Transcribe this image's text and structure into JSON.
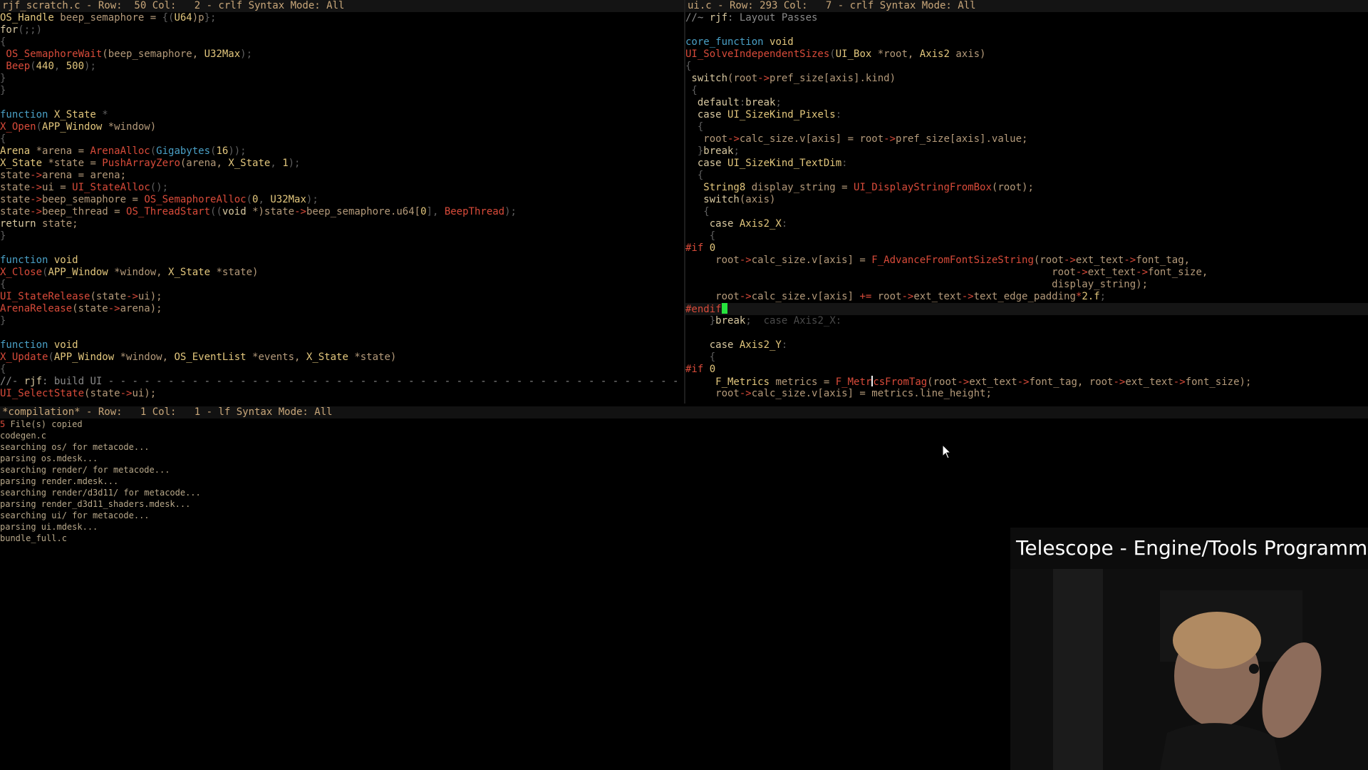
{
  "left_pane": {
    "status": "rjf_scratch.c - Row:  50 Col:   2 - crlf Syntax Mode: All",
    "lines": [
      [
        [
          "OS_Handle ",
          "t"
        ],
        [
          "beep_semaphore = ",
          "v"
        ],
        [
          "{(",
          "m"
        ],
        [
          "U64",
          "t"
        ],
        [
          ")p",
          "v"
        ],
        [
          "};",
          "m"
        ]
      ],
      [
        [
          "for",
          "k"
        ],
        [
          "(;;)",
          "m"
        ]
      ],
      [
        [
          "{",
          "m"
        ]
      ],
      [
        [
          " OS_SemaphoreWait",
          "f"
        ],
        [
          "(beep_semaphore, ",
          "v"
        ],
        [
          "U32Max",
          "t"
        ],
        [
          ");",
          "m"
        ]
      ],
      [
        [
          " Beep",
          "f"
        ],
        [
          "(",
          "m"
        ],
        [
          "440",
          "n"
        ],
        [
          ", ",
          "m"
        ],
        [
          "500",
          "n"
        ],
        [
          ");",
          "m"
        ]
      ],
      [
        [
          "}",
          "m"
        ]
      ],
      [
        [
          "}",
          "m"
        ]
      ],
      [
        [
          "",
          ""
        ]
      ],
      [
        [
          "function ",
          "a"
        ],
        [
          "X_State ",
          "t"
        ],
        [
          "*",
          "m"
        ]
      ],
      [
        [
          "X_Open",
          "f"
        ],
        [
          "(",
          "m"
        ],
        [
          "APP_Window ",
          "t"
        ],
        [
          "*window)",
          "v"
        ]
      ],
      [
        [
          "{",
          "m"
        ]
      ],
      [
        [
          "Arena ",
          "t"
        ],
        [
          "*arena = ",
          "v"
        ],
        [
          "ArenaAlloc",
          "f"
        ],
        [
          "(",
          "m"
        ],
        [
          "Gigabytes",
          "a"
        ],
        [
          "(",
          "m"
        ],
        [
          "16",
          "n"
        ],
        [
          "));",
          "m"
        ]
      ],
      [
        [
          "X_State ",
          "t"
        ],
        [
          "*state = ",
          "v"
        ],
        [
          "PushArrayZero",
          "f"
        ],
        [
          "(arena, ",
          "v"
        ],
        [
          "X_State",
          "t"
        ],
        [
          ", ",
          "m"
        ],
        [
          "1",
          "n"
        ],
        [
          ");",
          "m"
        ]
      ],
      [
        [
          "state",
          "v"
        ],
        [
          "->",
          "f"
        ],
        [
          "arena = arena;",
          "v"
        ]
      ],
      [
        [
          "state",
          "v"
        ],
        [
          "->",
          "f"
        ],
        [
          "ui = ",
          "v"
        ],
        [
          "UI_StateAlloc",
          "f"
        ],
        [
          "();",
          "m"
        ]
      ],
      [
        [
          "state",
          "v"
        ],
        [
          "->",
          "f"
        ],
        [
          "beep_semaphore = ",
          "v"
        ],
        [
          "OS_SemaphoreAlloc",
          "f"
        ],
        [
          "(",
          "m"
        ],
        [
          "0",
          "n"
        ],
        [
          ", ",
          "m"
        ],
        [
          "U32Max",
          "t"
        ],
        [
          ");",
          "m"
        ]
      ],
      [
        [
          "state",
          "v"
        ],
        [
          "->",
          "f"
        ],
        [
          "beep_thread = ",
          "v"
        ],
        [
          "OS_ThreadStart",
          "f"
        ],
        [
          "((",
          "m"
        ],
        [
          "void ",
          "k"
        ],
        [
          "*)state",
          "v"
        ],
        [
          "->",
          "f"
        ],
        [
          "beep_semaphore.u64[",
          "v"
        ],
        [
          "0",
          "n"
        ],
        [
          "], ",
          "m"
        ],
        [
          "BeepThread",
          "f"
        ],
        [
          ");",
          "m"
        ]
      ],
      [
        [
          "return ",
          "k"
        ],
        [
          "state;",
          "v"
        ]
      ],
      [
        [
          "}",
          "m"
        ]
      ],
      [
        [
          "",
          ""
        ]
      ],
      [
        [
          "function ",
          "a"
        ],
        [
          "void",
          "t"
        ]
      ],
      [
        [
          "X_Close",
          "f"
        ],
        [
          "(",
          "m"
        ],
        [
          "APP_Window ",
          "t"
        ],
        [
          "*window, ",
          "v"
        ],
        [
          "X_State ",
          "t"
        ],
        [
          "*state)",
          "v"
        ]
      ],
      [
        [
          "{",
          "m"
        ]
      ],
      [
        [
          "UI_StateRelease",
          "f"
        ],
        [
          "(state",
          "v"
        ],
        [
          "->",
          "f"
        ],
        [
          "ui);",
          "v"
        ]
      ],
      [
        [
          "ArenaRelease",
          "f"
        ],
        [
          "(state",
          "v"
        ],
        [
          "->",
          "f"
        ],
        [
          "arena);",
          "v"
        ]
      ],
      [
        [
          "}",
          "m"
        ]
      ],
      [
        [
          "",
          ""
        ]
      ],
      [
        [
          "function ",
          "a"
        ],
        [
          "void",
          "t"
        ]
      ],
      [
        [
          "X_Update",
          "f"
        ],
        [
          "(",
          "m"
        ],
        [
          "APP_Window ",
          "t"
        ],
        [
          "*window, ",
          "v"
        ],
        [
          "OS_EventList ",
          "t"
        ],
        [
          "*events, ",
          "v"
        ],
        [
          "X_State ",
          "t"
        ],
        [
          "*state)",
          "v"
        ]
      ],
      [
        [
          "{",
          "m"
        ]
      ],
      [
        [
          "//- ",
          "c"
        ],
        [
          "rjf",
          "k"
        ],
        [
          ": build UI - - - - - - - - - - - - - - - - - - - - - - - - - - - - - - - - - - - - - - - - - - - - - - - - - - - - - - - - - - - - - - - - - - - - -",
          "c"
        ]
      ],
      [
        [
          "UI_SelectState",
          "f"
        ],
        [
          "(state",
          "v"
        ],
        [
          "->",
          "f"
        ],
        [
          "ui);",
          "v"
        ]
      ]
    ]
  },
  "right_pane": {
    "status": "ui.c - Row: 293 Col:   7 - crlf Syntax Mode: All",
    "lines": [
      [
        [
          "//~ ",
          "c"
        ],
        [
          "rjf",
          "k"
        ],
        [
          ": Layout Passes",
          "c"
        ]
      ],
      [
        [
          "",
          ""
        ]
      ],
      [
        [
          "core_function ",
          "a"
        ],
        [
          "void",
          "t"
        ]
      ],
      [
        [
          "UI_SolveIndependentSizes",
          "f"
        ],
        [
          "(",
          "m"
        ],
        [
          "UI_Box ",
          "t"
        ],
        [
          "*root, ",
          "v"
        ],
        [
          "Axis2 ",
          "t"
        ],
        [
          "axis)",
          "v"
        ]
      ],
      [
        [
          "{",
          "m"
        ]
      ],
      [
        [
          " switch",
          "k"
        ],
        [
          "(root",
          "v"
        ],
        [
          "->",
          "f"
        ],
        [
          "pref_size[axis].kind)",
          "v"
        ]
      ],
      [
        [
          " {",
          "m"
        ]
      ],
      [
        [
          "  default",
          "k"
        ],
        [
          ":",
          "m"
        ],
        [
          "break",
          "k"
        ],
        [
          ";",
          "m"
        ]
      ],
      [
        [
          "  case ",
          "k"
        ],
        [
          "UI_SizeKind_Pixels",
          "t"
        ],
        [
          ":",
          "m"
        ]
      ],
      [
        [
          "  {",
          "m"
        ]
      ],
      [
        [
          "   root",
          "v"
        ],
        [
          "->",
          "f"
        ],
        [
          "calc_size.v[axis] = root",
          "v"
        ],
        [
          "->",
          "f"
        ],
        [
          "pref_size[axis].value;",
          "v"
        ]
      ],
      [
        [
          "  }",
          "m"
        ],
        [
          "break",
          "k"
        ],
        [
          ";",
          "m"
        ]
      ],
      [
        [
          "  case ",
          "k"
        ],
        [
          "UI_SizeKind_TextDim",
          "t"
        ],
        [
          ":",
          "m"
        ]
      ],
      [
        [
          "  {",
          "m"
        ]
      ],
      [
        [
          "   String8 ",
          "t"
        ],
        [
          "display_string = ",
          "v"
        ],
        [
          "UI_DisplayStringFromBox",
          "f"
        ],
        [
          "(root);",
          "v"
        ]
      ],
      [
        [
          "   switch",
          "k"
        ],
        [
          "(axis)",
          "v"
        ]
      ],
      [
        [
          "   {",
          "m"
        ]
      ],
      [
        [
          "    case ",
          "k"
        ],
        [
          "Axis2_X",
          "t"
        ],
        [
          ":",
          "m"
        ]
      ],
      [
        [
          "    {",
          "m"
        ]
      ],
      [
        [
          "#if ",
          "f"
        ],
        [
          "0",
          "n"
        ]
      ],
      [
        [
          "     root",
          "v"
        ],
        [
          "->",
          "f"
        ],
        [
          "calc_size.v[axis] = ",
          "v"
        ],
        [
          "F_AdvanceFromFontSizeString",
          "f"
        ],
        [
          "(root",
          "v"
        ],
        [
          "->",
          "f"
        ],
        [
          "ext_text",
          "v"
        ],
        [
          "->",
          "f"
        ],
        [
          "font_tag,",
          "v"
        ]
      ],
      [
        [
          "                                                             root",
          "v"
        ],
        [
          "->",
          "f"
        ],
        [
          "ext_text",
          "v"
        ],
        [
          "->",
          "f"
        ],
        [
          "font_size,",
          "v"
        ]
      ],
      [
        [
          "                                                             display_string);",
          "v"
        ]
      ],
      [
        [
          "     root",
          "v"
        ],
        [
          "->",
          "f"
        ],
        [
          "calc_size.v[axis] ",
          "v"
        ],
        [
          "+= ",
          "f"
        ],
        [
          "root",
          "v"
        ],
        [
          "->",
          "f"
        ],
        [
          "ext_text",
          "v"
        ],
        [
          "->",
          "f"
        ],
        [
          "text_edge_padding",
          "v"
        ],
        [
          "*",
          "f"
        ],
        [
          "2.f",
          "n"
        ],
        [
          ";",
          "m"
        ]
      ],
      [
        [
          "#endif",
          "f"
        ],
        [
          "CURSOR",
          "cursor"
        ]
      ],
      [
        [
          "    }",
          "m"
        ],
        [
          "break",
          "k"
        ],
        [
          ";  ",
          "m"
        ],
        [
          "case Axis2_X:",
          "g"
        ]
      ],
      [
        [
          "",
          ""
        ]
      ],
      [
        [
          "    case ",
          "k"
        ],
        [
          "Axis2_Y",
          "t"
        ],
        [
          ":",
          "m"
        ]
      ],
      [
        [
          "    {",
          "m"
        ]
      ],
      [
        [
          "#if ",
          "f"
        ],
        [
          "0",
          "n"
        ]
      ],
      [
        [
          "     F_Metrics ",
          "t"
        ],
        [
          "metrics = ",
          "v"
        ],
        [
          "F_Metr",
          "f"
        ],
        [
          "CARET",
          "caret"
        ],
        [
          "csFromTag",
          "f"
        ],
        [
          "(root",
          "v"
        ],
        [
          "->",
          "f"
        ],
        [
          "ext_text",
          "v"
        ],
        [
          "->",
          "f"
        ],
        [
          "font_tag, root",
          "v"
        ],
        [
          "->",
          "f"
        ],
        [
          "ext_text",
          "v"
        ],
        [
          "->",
          "f"
        ],
        [
          "font_size);",
          "v"
        ]
      ],
      [
        [
          "     root",
          "v"
        ],
        [
          "->",
          "f"
        ],
        [
          "calc_size.v[axis] = metrics.line_height;",
          "v"
        ]
      ]
    ]
  },
  "compilation": {
    "status": "*compilation* - Row:   1 Col:   1 - lf Syntax Mode: All",
    "lines": [
      "5 File(s) copied",
      "codegen.c",
      "searching os/ for metacode...",
      "parsing os.mdesk...",
      "searching render/ for metacode...",
      "parsing render.mdesk...",
      "searching render/d3d11/ for metacode...",
      "parsing render_d3d11_shaders.mdesk...",
      "searching ui/ for metacode...",
      "parsing ui.mdesk...",
      "bundle_full.c"
    ]
  },
  "webcam": {
    "title": "Telescope - Engine/Tools Programming in C"
  },
  "colors": {
    "background": "#000000",
    "cursor": "#27e33e",
    "function": "#d94b3a",
    "type": "#e3c77d",
    "keyword_blue": "#4aa0c6"
  }
}
